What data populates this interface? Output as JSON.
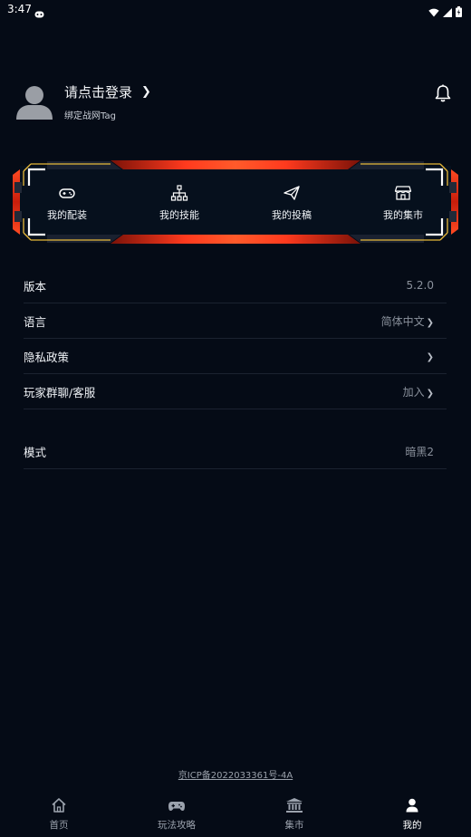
{
  "status_bar": {
    "time": "3:47"
  },
  "profile": {
    "login_text": "请点击登录",
    "login_chevron": "❯",
    "bind_tag": "绑定战网Tag"
  },
  "quick_actions": [
    {
      "label": "我的配装",
      "icon": "gamepad-icon"
    },
    {
      "label": "我的技能",
      "icon": "skill-tree-icon"
    },
    {
      "label": "我的投稿",
      "icon": "paper-plane-icon"
    },
    {
      "label": "我的集市",
      "icon": "shop-icon"
    }
  ],
  "settings": [
    {
      "label": "版本",
      "value": "5.2.0",
      "chevron": ""
    },
    {
      "label": "语言",
      "value": "简体中文",
      "chevron": "❯"
    },
    {
      "label": "隐私政策",
      "value": "",
      "chevron": "❯"
    },
    {
      "label": "玩家群聊/客服",
      "value": "加入",
      "chevron": "❯"
    }
  ],
  "mode": {
    "label": "模式",
    "value": "暗黑2"
  },
  "footer": {
    "icp": "京ICP备2022033361号-4A"
  },
  "bottom_nav": [
    {
      "label": "首页",
      "icon": "home-icon",
      "active": false
    },
    {
      "label": "玩法攻略",
      "icon": "gamepad-icon",
      "active": false
    },
    {
      "label": "集市",
      "icon": "market-building-icon",
      "active": false
    },
    {
      "label": "我的",
      "icon": "person-icon",
      "active": true
    }
  ],
  "colors": {
    "background": "#050b16",
    "banner_red": "#e8321c",
    "banner_gold": "#e8b93a",
    "nav_active": "#ffffff",
    "nav_inactive": "#9ba2ad"
  }
}
